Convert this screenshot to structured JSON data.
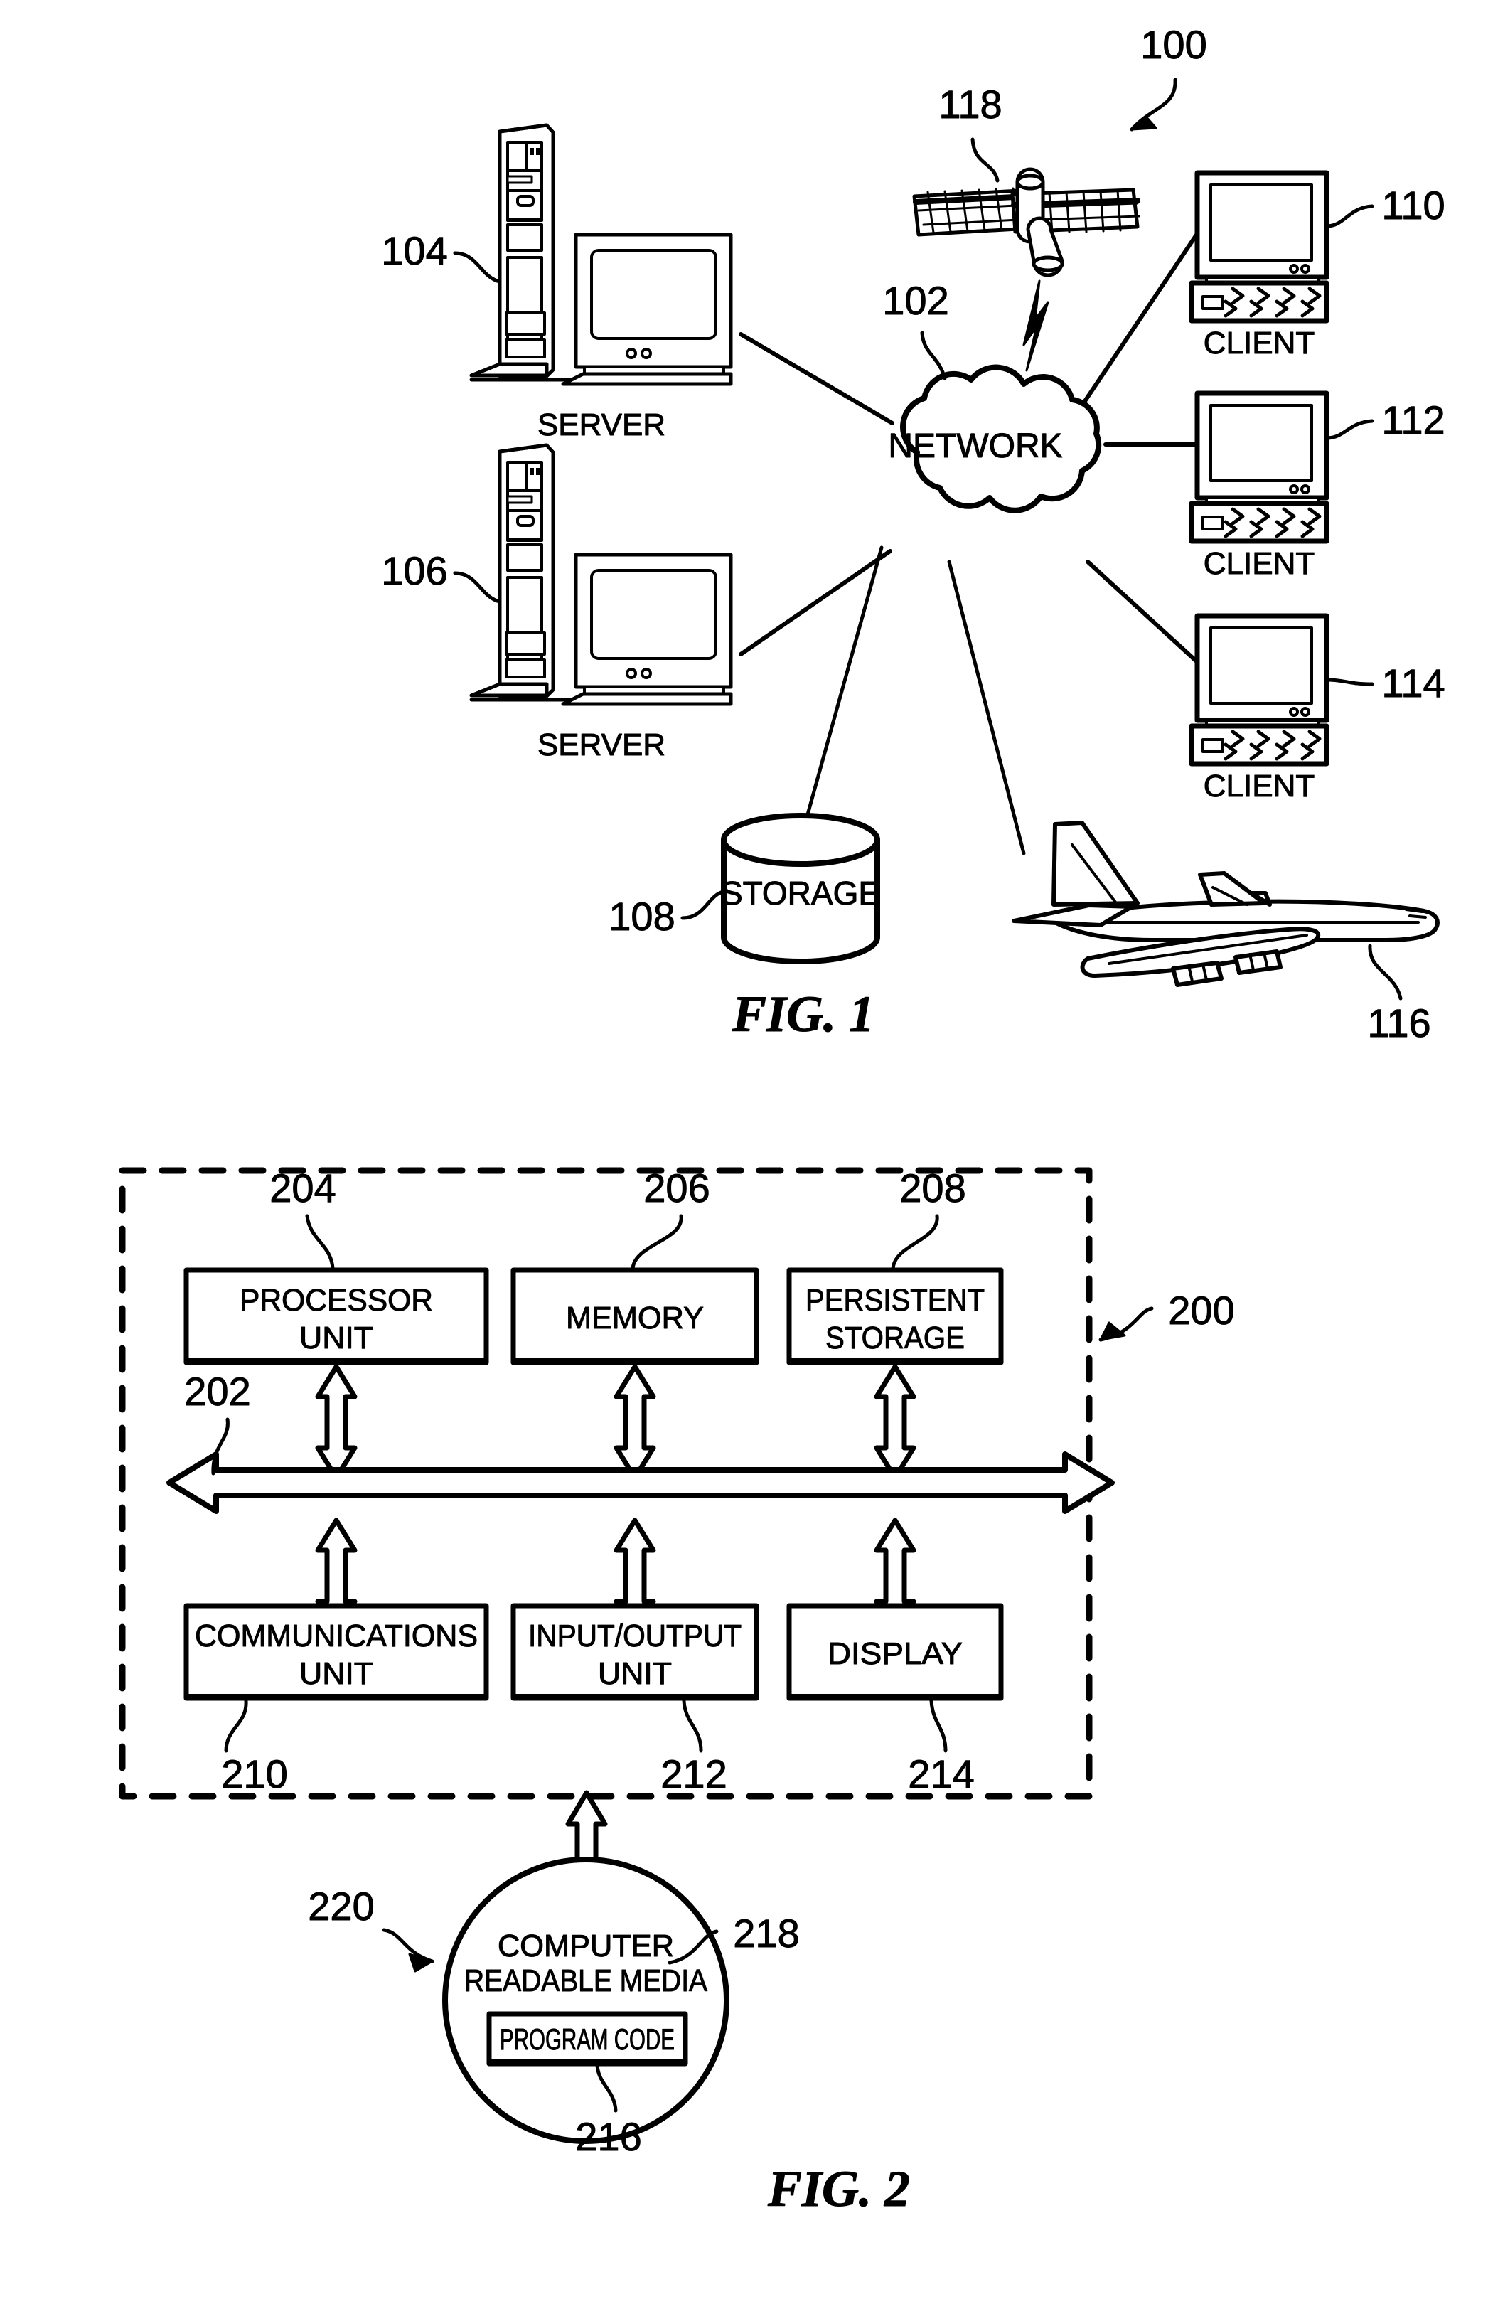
{
  "figure1": {
    "caption": "FIG. 1",
    "system_ref": "100",
    "network": {
      "label": "NETWORK",
      "ref": "102"
    },
    "satellite": {
      "ref": "118",
      "name": "satellite-icon"
    },
    "servers": [
      {
        "label": "SERVER",
        "ref": "104"
      },
      {
        "label": "SERVER",
        "ref": "106"
      }
    ],
    "clients": [
      {
        "label": "CLIENT",
        "ref": "110"
      },
      {
        "label": "CLIENT",
        "ref": "112"
      },
      {
        "label": "CLIENT",
        "ref": "114"
      }
    ],
    "storage": {
      "label": "STORAGE",
      "ref": "108"
    },
    "aircraft": {
      "ref": "116",
      "name": "airplane-icon"
    }
  },
  "figure2": {
    "caption": "FIG. 2",
    "data_processing_system_ref": "200",
    "bus": {
      "ref": "202",
      "name": "communications-fabric-bus"
    },
    "top_boxes": [
      {
        "lines": [
          "PROCESSOR",
          "UNIT"
        ],
        "ref": "204"
      },
      {
        "lines": [
          "MEMORY"
        ],
        "ref": "206"
      },
      {
        "lines": [
          "PERSISTENT",
          "STORAGE"
        ],
        "ref": "208"
      }
    ],
    "bottom_boxes": [
      {
        "lines": [
          "COMMUNICATIONS",
          "UNIT"
        ],
        "ref": "210"
      },
      {
        "lines": [
          "INPUT/OUTPUT",
          "UNIT"
        ],
        "ref": "212"
      },
      {
        "lines": [
          "DISPLAY"
        ],
        "ref": "214"
      }
    ],
    "media": {
      "lines": [
        "COMPUTER",
        "READABLE MEDIA"
      ],
      "ref": "218",
      "program_code": {
        "label": "PROGRAM CODE",
        "ref": "216"
      },
      "product_ref": "220"
    }
  },
  "colors": {
    "ink": "#000000",
    "paper": "#ffffff"
  }
}
